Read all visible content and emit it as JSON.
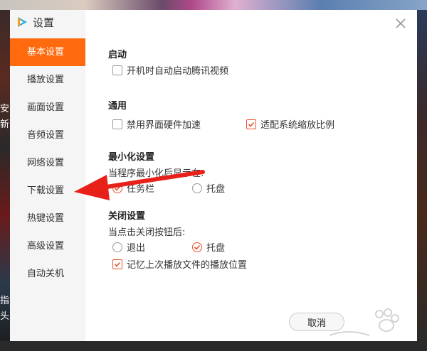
{
  "background": {
    "edge_texts": [
      "安",
      "新",
      "指",
      "头"
    ]
  },
  "dialog": {
    "title": "设置",
    "logo_icon": "tencent-video-logo-icon",
    "close_icon": "close-icon",
    "nav": [
      {
        "label": "基本设置",
        "active": true
      },
      {
        "label": "播放设置",
        "active": false
      },
      {
        "label": "画面设置",
        "active": false
      },
      {
        "label": "音频设置",
        "active": false
      },
      {
        "label": "网络设置",
        "active": false
      },
      {
        "label": "下载设置",
        "active": false
      },
      {
        "label": "热键设置",
        "active": false
      },
      {
        "label": "高级设置",
        "active": false
      },
      {
        "label": "自动关机",
        "active": false
      }
    ],
    "sections": {
      "startup": {
        "title": "启动",
        "auto_start": {
          "label": "开机时自动启动腾讯视频",
          "checked": false
        }
      },
      "general": {
        "title": "通用",
        "disable_hw": {
          "label": "禁用界面硬件加速",
          "checked": false
        },
        "system_scale": {
          "label": "适配系统缩放比例",
          "checked": true
        }
      },
      "minimize": {
        "title": "最小化设置",
        "prompt": "当程序最小化后显示在:",
        "opt_taskbar": {
          "label": "任务栏",
          "checked": true
        },
        "opt_tray": {
          "label": "托盘",
          "checked": false
        }
      },
      "close": {
        "title": "关闭设置",
        "prompt": "当点击关闭按钮后:",
        "opt_exit": {
          "label": "退出",
          "checked": false
        },
        "opt_tray": {
          "label": "托盘",
          "checked": true
        },
        "remember_position": {
          "label": "记忆上次播放文件的播放位置",
          "checked": true
        }
      }
    },
    "cancel_label": "取消"
  },
  "colors": {
    "accent": "#ff6a0e",
    "check": "#e8522b",
    "arrow": "#e8201a"
  }
}
